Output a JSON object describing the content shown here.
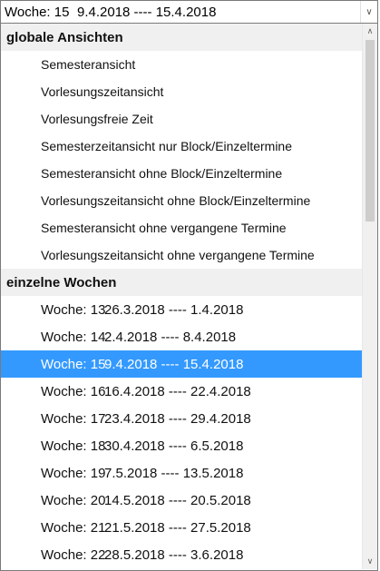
{
  "select": {
    "week_label": "Woche: 15",
    "range": "9.4.2018 ---- 15.4.2018",
    "arrow_icon": "chevron-down-icon"
  },
  "groups": {
    "global": {
      "header": "globale Ansichten",
      "items": [
        "Semesteransicht",
        "Vorlesungszeitansicht",
        "Vorlesungsfreie Zeit",
        "Semesterzeitansicht nur Block/Einzeltermine",
        "Semesteransicht ohne Block/Einzeltermine",
        "Vorlesungszeitansicht ohne Block/Einzeltermine",
        "Semesteransicht ohne vergangene Termine",
        "Vorlesungszeitansicht ohne vergangene Termine"
      ]
    },
    "weeks": {
      "header": "einzelne Wochen",
      "items": [
        {
          "week": "Woche: 13",
          "range": "26.3.2018 ---- 1.4.2018"
        },
        {
          "week": "Woche: 14",
          "range": "2.4.2018 ---- 8.4.2018"
        },
        {
          "week": "Woche: 15",
          "range": "9.4.2018 ---- 15.4.2018",
          "selected": true
        },
        {
          "week": "Woche: 16",
          "range": "16.4.2018 ---- 22.4.2018"
        },
        {
          "week": "Woche: 17",
          "range": "23.4.2018 ---- 29.4.2018"
        },
        {
          "week": "Woche: 18",
          "range": "30.4.2018 ---- 6.5.2018"
        },
        {
          "week": "Woche: 19",
          "range": "7.5.2018 ---- 13.5.2018"
        },
        {
          "week": "Woche: 20",
          "range": "14.5.2018 ---- 20.5.2018"
        },
        {
          "week": "Woche: 21",
          "range": "21.5.2018 ---- 27.5.2018"
        },
        {
          "week": "Woche: 22",
          "range": "28.5.2018 ---- 3.6.2018"
        }
      ]
    }
  },
  "colors": {
    "selection": "#3399ff",
    "header_bg": "#f0f0f0"
  }
}
